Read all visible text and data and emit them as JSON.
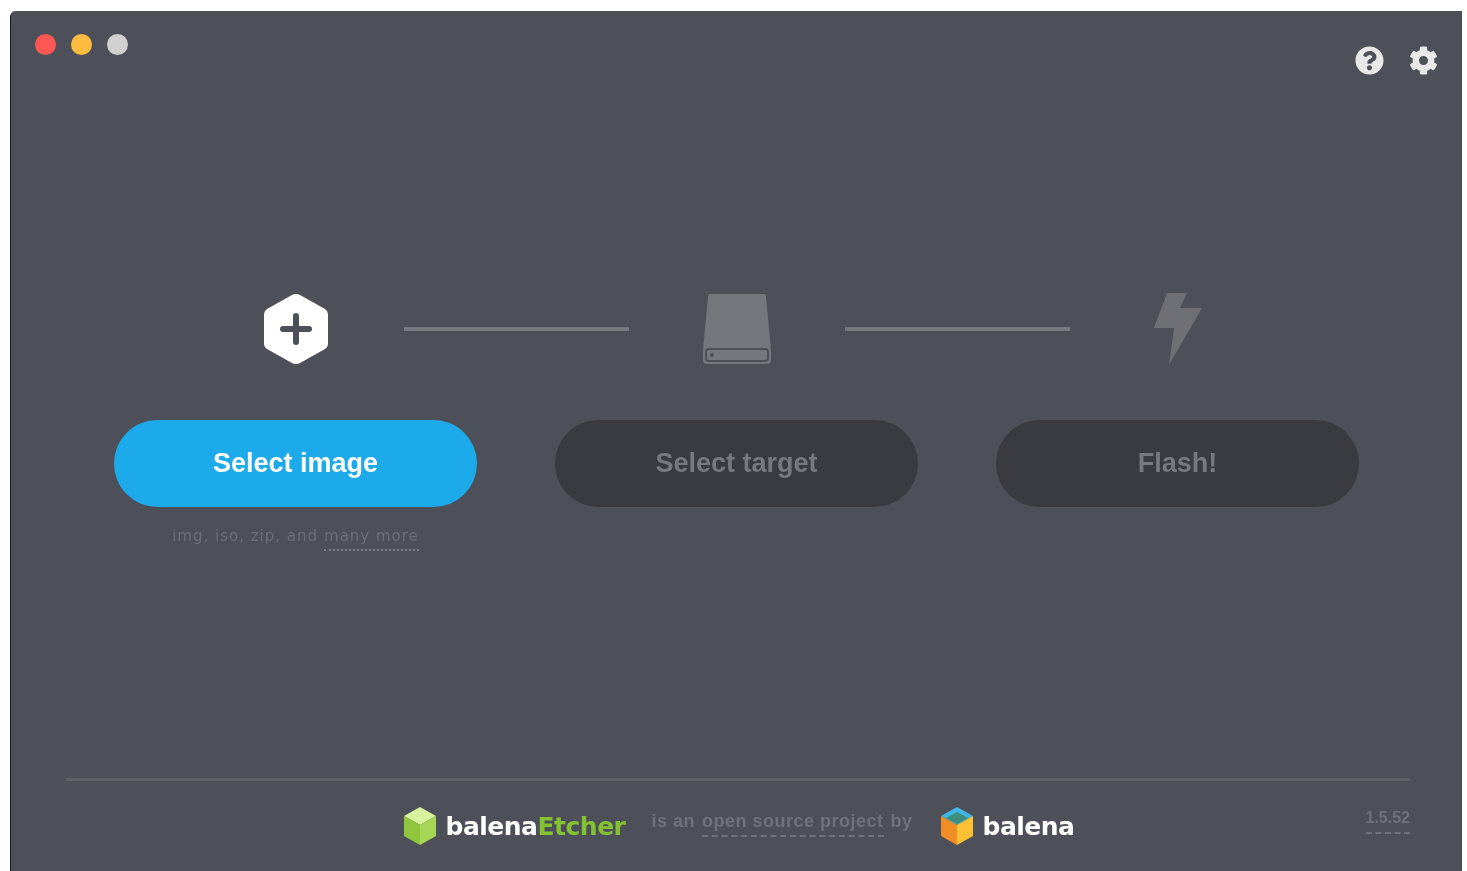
{
  "window": {
    "controls": [
      {
        "color": "#fc5753"
      },
      {
        "color": "#fdbc40"
      },
      {
        "color": "#d0d0d0"
      }
    ]
  },
  "toolbar": [
    {
      "kind": "help"
    },
    {
      "kind": "settings"
    }
  ],
  "steps": [
    {
      "kind": "image",
      "button": "Select image",
      "disabled": false,
      "note": "img, iso, zip, and",
      "note_link": "many more"
    },
    {
      "kind": "drive",
      "button": "Select target",
      "disabled": true
    },
    {
      "kind": "flash",
      "button": "Flash!",
      "disabled": true
    }
  ],
  "footer": {
    "product_prefix": "balena",
    "product_suffix": "Etcher",
    "tagline_start": "is an",
    "tagline_link": "open source project",
    "tagline_end": "by",
    "company": "balena",
    "version": "1.5.52"
  }
}
